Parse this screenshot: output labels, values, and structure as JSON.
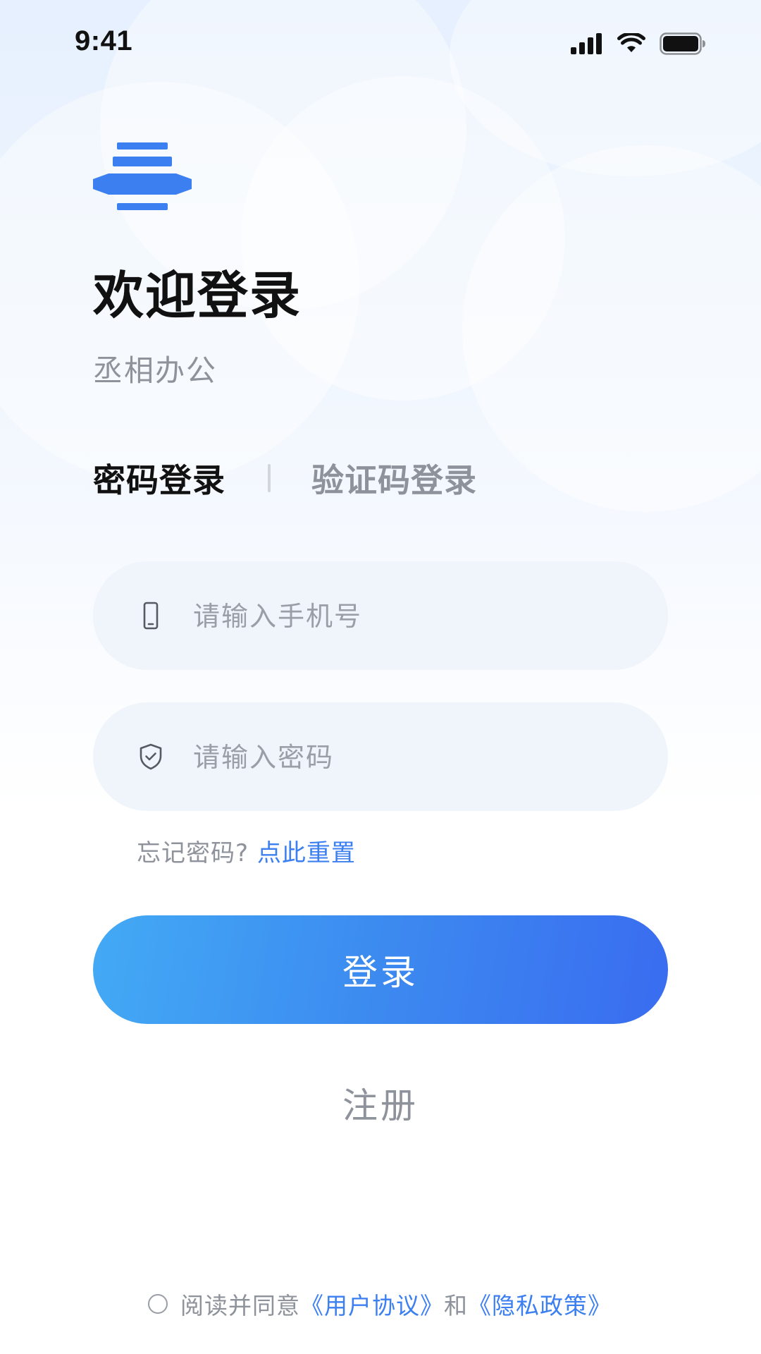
{
  "status_bar": {
    "time": "9:41",
    "icons": [
      "signal-icon",
      "wifi-icon",
      "battery-icon"
    ]
  },
  "header": {
    "logo": "app-logo",
    "title": "欢迎登录",
    "subtitle": "丞相办公"
  },
  "tabs": {
    "active": "密码登录",
    "inactive": "验证码登录"
  },
  "form": {
    "phone_placeholder": "请输入手机号",
    "phone_icon": "phone-icon",
    "password_placeholder": "请输入密码",
    "password_icon": "shield-icon",
    "forgot_text": "忘记密码?",
    "forgot_link": "点此重置"
  },
  "actions": {
    "login_label": "登录",
    "register_label": "注册"
  },
  "agreement": {
    "prefix": "阅读并同意",
    "user_agreement": "《用户协议》",
    "conjunction": "和",
    "privacy_policy": "《隐私政策》"
  },
  "colors": {
    "accent": "#3b7ff0",
    "button_gradient_start": "#43aaf5",
    "button_gradient_end": "#3a6cf0",
    "title": "#111111",
    "muted": "#8e929a"
  }
}
